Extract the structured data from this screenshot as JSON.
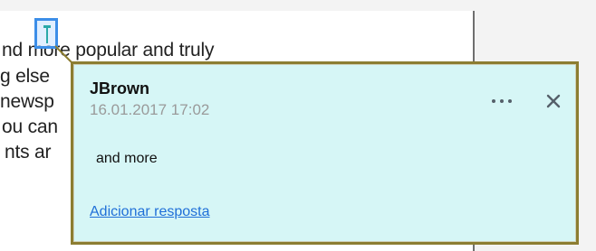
{
  "document": {
    "lines": [
      "nd more popular and truly",
      "g else",
      "newsp",
      "ou can",
      "nts ar"
    ]
  },
  "comment": {
    "author": "JBrown",
    "timestamp": "16.01.2017 17:02",
    "body": "and more",
    "reply_label": "Adicionar resposta",
    "more_icon": "more-options-icon",
    "close_icon": "close-icon"
  },
  "colors": {
    "popup_background": "#d6f6f6",
    "popup_border": "#8c7d31",
    "marker_border": "#3c8ee8",
    "link": "#1f6fd8"
  }
}
